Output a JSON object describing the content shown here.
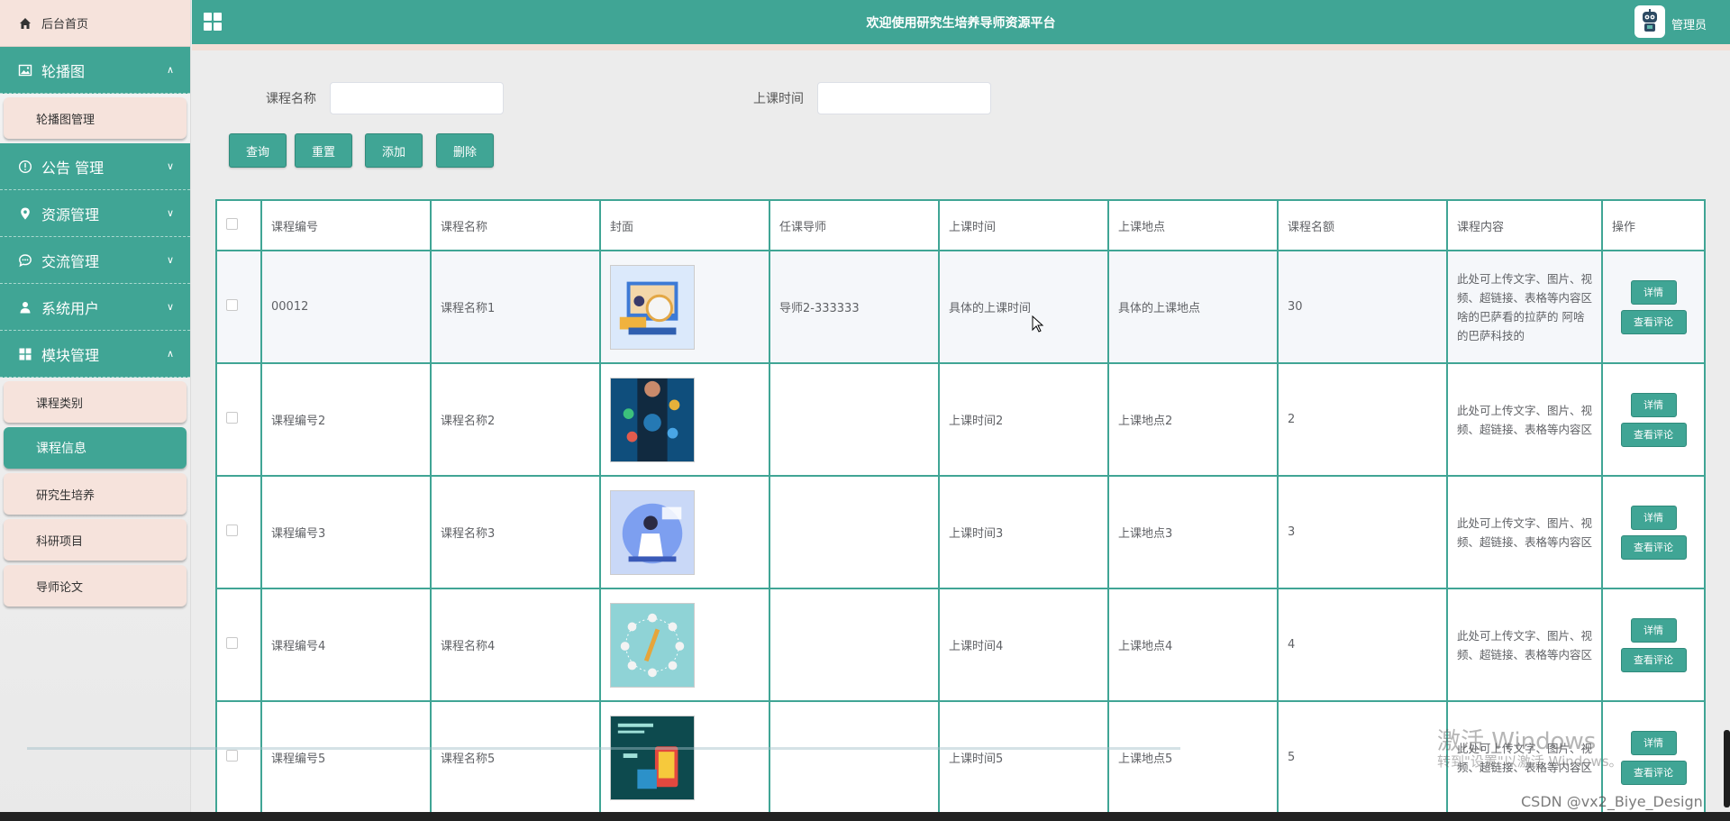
{
  "app": {
    "title": "欢迎使用研究生培养导师资源平台",
    "role": "管理员"
  },
  "sidebar": {
    "home": "后台首页",
    "groups": [
      {
        "label": "轮播图",
        "arrow": "^",
        "subs": [
          "轮播图管理"
        ]
      },
      {
        "label": "公告 管理",
        "arrow": "v",
        "subs": []
      },
      {
        "label": "资源管理",
        "arrow": "v",
        "subs": []
      },
      {
        "label": "交流管理",
        "arrow": "v",
        "subs": []
      },
      {
        "label": "系统用户",
        "arrow": "v",
        "subs": []
      },
      {
        "label": "模块管理",
        "arrow": "^",
        "subs": [
          "课程类别",
          "课程信息",
          "研究生培养",
          "科研项目",
          "导师论文"
        ]
      }
    ],
    "active_sub": "课程信息"
  },
  "search": {
    "name_label": "课程名称",
    "time_label": "上课时间",
    "name_value": "",
    "time_value": ""
  },
  "buttons": {
    "query": "查询",
    "reset": "重置",
    "add": "添加",
    "delete": "删除"
  },
  "table": {
    "headers": [
      "课程编号",
      "课程名称",
      "封面",
      "任课导师",
      "上课时间",
      "上课地点",
      "课程名额",
      "课程内容",
      "操作"
    ],
    "rows": [
      {
        "code": "00012",
        "name": "课程名称1",
        "teacher": "导师2-333333",
        "time": "具体的上课时间",
        "place": "具体的上课地点",
        "quota": "30",
        "content": "此处可上传文字、图片、视频、超链接、表格等内容区啥的巴萨看的拉萨的 阿啥的巴萨科技的"
      },
      {
        "code": "课程编号2",
        "name": "课程名称2",
        "teacher": "",
        "time": "上课时间2",
        "place": "上课地点2",
        "quota": "2",
        "content": "此处可上传文字、图片、视频、超链接、表格等内容区"
      },
      {
        "code": "课程编号3",
        "name": "课程名称3",
        "teacher": "",
        "time": "上课时间3",
        "place": "上课地点3",
        "quota": "3",
        "content": "此处可上传文字、图片、视频、超链接、表格等内容区"
      },
      {
        "code": "课程编号4",
        "name": "课程名称4",
        "teacher": "",
        "time": "上课时间4",
        "place": "上课地点4",
        "quota": "4",
        "content": "此处可上传文字、图片、视频、超链接、表格等内容区"
      },
      {
        "code": "课程编号5",
        "name": "课程名称5",
        "teacher": "",
        "time": "上课时间5",
        "place": "上课地点5",
        "quota": "5",
        "content": "此处可上传文字、图片、视频、超链接、表格等内容区"
      }
    ],
    "op_detail": "详情",
    "op_comment": "查看评论"
  },
  "overlay": {
    "watermark": "激活 Windows",
    "watermark_sub": "转到\"设置\"以激活 Windows。",
    "credit": "CSDN @vx2_Biye_Design"
  },
  "colors": {
    "primary": "#40a595",
    "soft": "#f6e3dc"
  }
}
